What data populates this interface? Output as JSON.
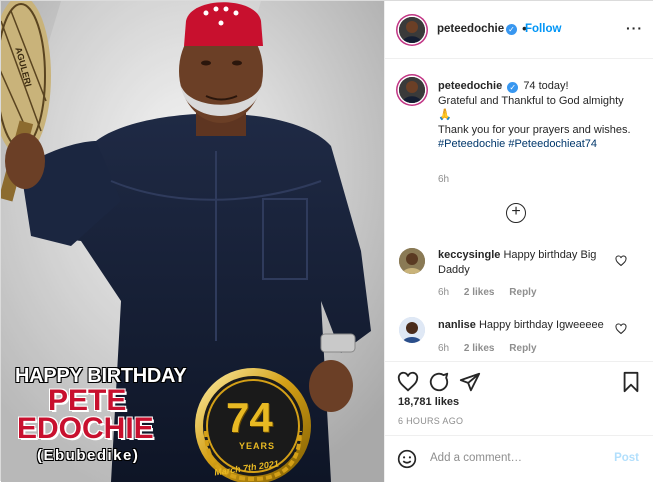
{
  "post": {
    "image": {
      "headline": "HAPPY BIRTHDAY",
      "name_line1": "PETE",
      "name_line2": "EDOCHIE",
      "nickname": "(Ebubedike)",
      "badge_number": "74",
      "badge_years": "YEARS",
      "badge_date": "March 7th 2021",
      "fan_text": "AGULERI"
    },
    "header": {
      "username": "peteedochie",
      "follow_label": "Follow",
      "more_icon": "more-dots-icon"
    },
    "caption": {
      "username": "peteedochie",
      "text_1": "74 today!",
      "text_2": "Grateful and Thankful to God almighty",
      "pray_emoji": "🙏",
      "text_3": "Thank you for your prayers and wishes.",
      "hashtags": "#Peteedochie #Peteedochieat74",
      "time": "6h"
    },
    "load_more_icon": "plus-circle-icon",
    "comments": [
      {
        "username": "keccysingle",
        "text": "Happy birthday Big Daddy",
        "time": "6h",
        "likes": "2 likes",
        "reply": "Reply"
      },
      {
        "username": "nanlise",
        "text": "Happy birthday Igweeeee",
        "time": "6h",
        "likes": "2 likes",
        "reply": "Reply"
      }
    ],
    "actions": {
      "like_icon": "heart-icon",
      "comment_icon": "comment-icon",
      "share_icon": "share-icon",
      "save_icon": "bookmark-icon"
    },
    "likes_count": "18,781 likes",
    "posted_ago": "6 HOURS AGO",
    "add_comment": {
      "placeholder": "Add a comment…",
      "post_label": "Post",
      "emoji_icon": "smiley-icon"
    },
    "colors": {
      "accent_blue": "#0095f6",
      "verified_blue": "#3897f0",
      "hashtag": "#00376b",
      "gold": "#d4a017",
      "name_red": "#c8102e"
    }
  }
}
